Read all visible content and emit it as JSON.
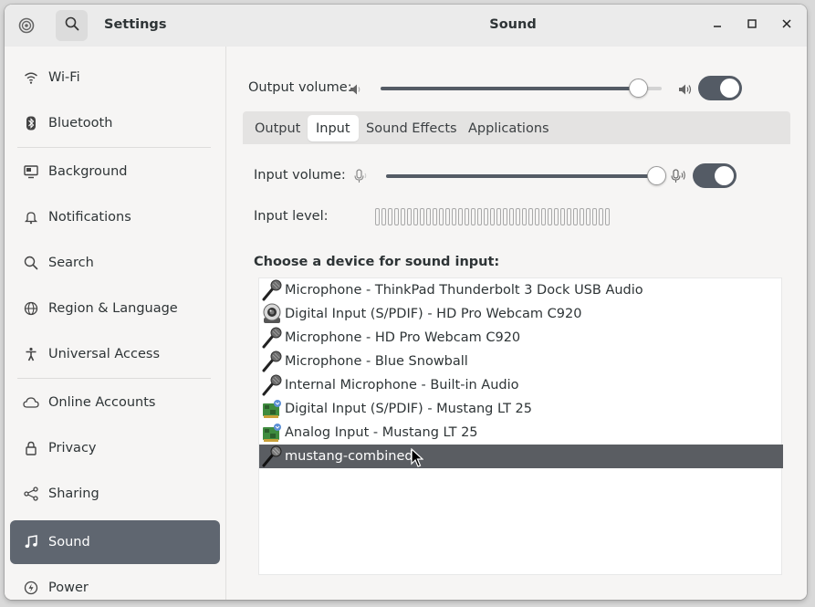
{
  "header": {
    "app_title": "Settings",
    "page_title": "Sound",
    "app_icon": "settings-app-icon",
    "search_icon": "search-icon"
  },
  "window_controls": [
    "minimize-icon",
    "maximize-icon",
    "close-icon"
  ],
  "sidebar": {
    "items": [
      {
        "label": "Wi-Fi",
        "icon": "wifi-icon"
      },
      {
        "label": "Bluetooth",
        "icon": "bluetooth-icon"
      },
      {
        "label": "Background",
        "icon": "display-icon"
      },
      {
        "label": "Notifications",
        "icon": "bell-icon"
      },
      {
        "label": "Search",
        "icon": "search-icon"
      },
      {
        "label": "Region & Language",
        "icon": "globe-icon"
      },
      {
        "label": "Universal Access",
        "icon": "accessibility-icon"
      },
      {
        "label": "Online Accounts",
        "icon": "cloud-icon"
      },
      {
        "label": "Privacy",
        "icon": "lock-icon"
      },
      {
        "label": "Sharing",
        "icon": "share-icon"
      },
      {
        "label": "Sound",
        "icon": "music-note-icon",
        "active": true
      },
      {
        "label": "Power",
        "icon": "power-icon"
      }
    ]
  },
  "output": {
    "label": "Output volume:",
    "volume_fraction": 0.915,
    "enabled": true
  },
  "tabs": [
    {
      "label": "Output"
    },
    {
      "label": "Input",
      "active": true
    },
    {
      "label": "Sound Effects"
    },
    {
      "label": "Applications"
    }
  ],
  "input": {
    "volume_label": "Input volume:",
    "volume_fraction": 1.0,
    "enabled": true,
    "level_label": "Input level:",
    "level_fraction": 0.0,
    "choose_label": "Choose a device for sound input:"
  },
  "devices": [
    {
      "label": "Microphone - ThinkPad Thunderbolt 3 Dock USB Audio",
      "icon": "microphone-icon"
    },
    {
      "label": "Digital Input (S/PDIF) - HD Pro Webcam C920",
      "icon": "webcam-icon"
    },
    {
      "label": "Microphone - HD Pro Webcam C920",
      "icon": "microphone-icon"
    },
    {
      "label": "Microphone - Blue Snowball",
      "icon": "microphone-icon"
    },
    {
      "label": "Internal Microphone - Built-in Audio",
      "icon": "microphone-icon"
    },
    {
      "label": "Digital Input (S/PDIF) - Mustang LT 25",
      "icon": "sound-card-icon"
    },
    {
      "label": "Analog Input - Mustang LT 25",
      "icon": "sound-card-icon"
    },
    {
      "label": "mustang-combined",
      "icon": "microphone-icon",
      "selected": true
    }
  ],
  "colors": {
    "accent": "#545b65",
    "sidebar_active": "#5f6670",
    "selected_row": "#5a5d62"
  }
}
